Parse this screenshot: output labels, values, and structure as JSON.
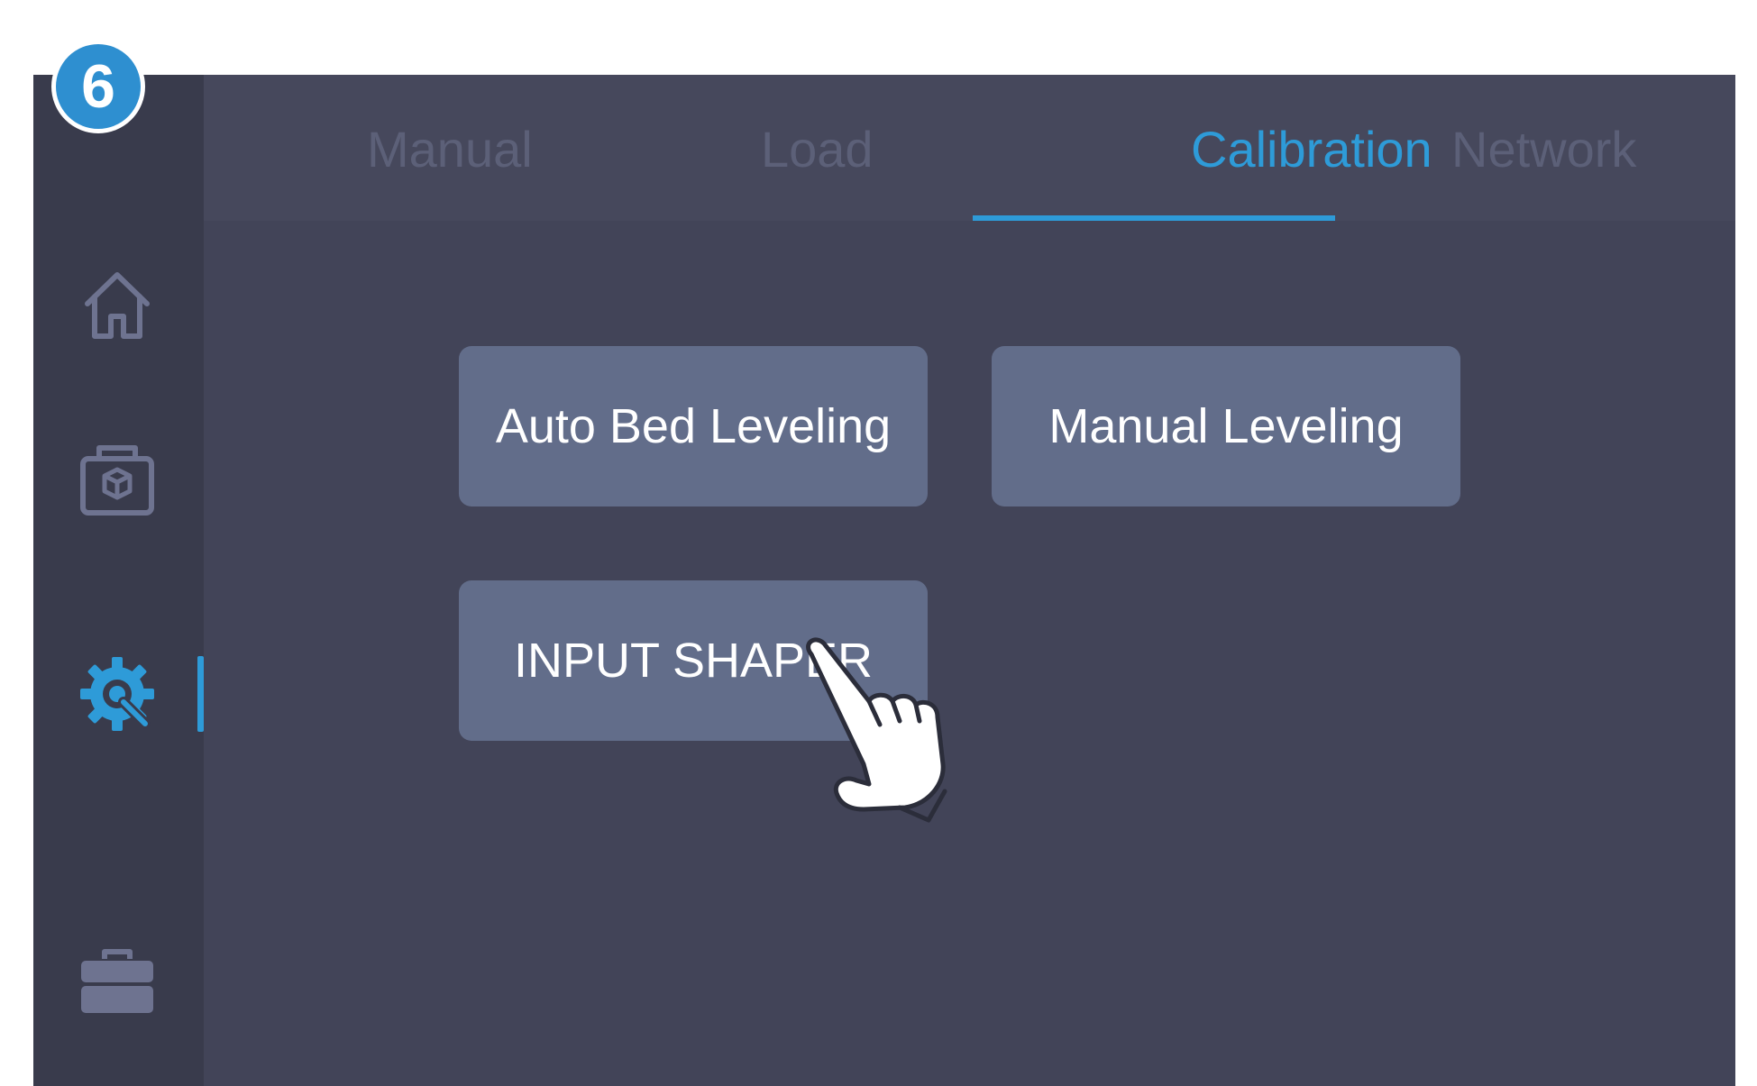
{
  "step_badge": "6",
  "tabs": [
    {
      "label": "Manual",
      "active": false
    },
    {
      "label": "Load",
      "active": false
    },
    {
      "label": "Calibration",
      "active": true
    },
    {
      "label": "Network",
      "active": false
    }
  ],
  "sidebar": {
    "items": [
      {
        "icon": "home-icon",
        "active": false
      },
      {
        "icon": "print-box-icon",
        "active": false
      },
      {
        "icon": "settings-gear-icon",
        "active": true
      },
      {
        "icon": "toolbox-icon",
        "active": false
      }
    ]
  },
  "buttons": {
    "auto_bed_leveling": "Auto Bed Leveling",
    "manual_leveling": "Manual Leveling",
    "input_shaper": "INPUT SHAPER"
  },
  "colors": {
    "accent": "#2e9bd8",
    "background": "#424458",
    "sidebar": "#393b4c",
    "button": "#626d8a"
  }
}
